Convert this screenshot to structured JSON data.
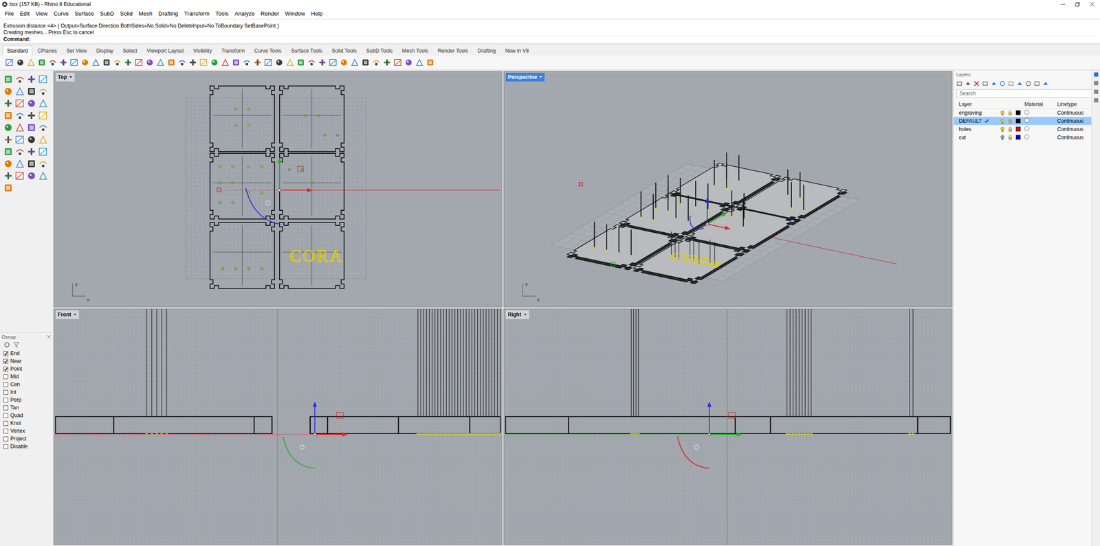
{
  "window": {
    "title": "box (157 KB) - Rhino 8 Educational"
  },
  "menu": [
    "File",
    "Edit",
    "View",
    "Curve",
    "Surface",
    "SubD",
    "Solid",
    "Mesh",
    "Drafting",
    "Transform",
    "Tools",
    "Analyze",
    "Render",
    "Window",
    "Help"
  ],
  "command": {
    "history": [
      "Extrusion distance <4> ( Output=Surface Direction BothSides=No Solid=No DeleteInput=No ToBoundary SetBasePoint )",
      "Creating meshes... Press Esc to cancel"
    ],
    "prompt": "Command:"
  },
  "toolbar_tabs": [
    {
      "label": "Standard",
      "selected": true
    },
    {
      "label": "CPlanes",
      "selected": false
    },
    {
      "label": "Set View",
      "selected": false
    },
    {
      "label": "Display",
      "selected": false
    },
    {
      "label": "Select",
      "selected": false
    },
    {
      "label": "Viewport Layout",
      "selected": false
    },
    {
      "label": "Visibility",
      "selected": false
    },
    {
      "label": "Transform",
      "selected": false
    },
    {
      "label": "Curve Tools",
      "selected": false
    },
    {
      "label": "Surface Tools",
      "selected": false
    },
    {
      "label": "Solid Tools",
      "selected": false
    },
    {
      "label": "SubD Tools",
      "selected": false
    },
    {
      "label": "Mesh Tools",
      "selected": false
    },
    {
      "label": "Render Tools",
      "selected": false
    },
    {
      "label": "Drafting",
      "selected": false
    },
    {
      "label": "New in V8",
      "selected": false
    }
  ],
  "viewports": [
    {
      "label": "Top",
      "active": false,
      "kind": "top",
      "axes": [
        "y",
        "x"
      ]
    },
    {
      "label": "Perspective",
      "active": true,
      "kind": "perspective",
      "axes": [
        "y",
        "x"
      ]
    },
    {
      "label": "Front",
      "active": false,
      "kind": "front",
      "axes": []
    },
    {
      "label": "Right",
      "active": false,
      "kind": "right",
      "axes": []
    }
  ],
  "engraving_text": "CORA",
  "layers": {
    "title": "Layers",
    "search_placeholder": "Search",
    "columns": [
      "Layer",
      "Material",
      "Linetype"
    ],
    "rows": [
      {
        "name": "engraving",
        "current": false,
        "selected": false,
        "visible": true,
        "color": "#000000",
        "linetype": "Continuous"
      },
      {
        "name": "DEFAULT",
        "current": true,
        "selected": true,
        "visible": true,
        "color": "#000000",
        "linetype": "Continuous"
      },
      {
        "name": "holes",
        "current": false,
        "selected": false,
        "visible": true,
        "color": "#e00000",
        "linetype": "Continuous"
      },
      {
        "name": "cut",
        "current": false,
        "selected": false,
        "visible": false,
        "color": "#0000e0",
        "linetype": "Continuous"
      }
    ]
  },
  "osnap": {
    "title": "Osnap",
    "items": [
      {
        "label": "End",
        "checked": true
      },
      {
        "label": "Near",
        "checked": true
      },
      {
        "label": "Point",
        "checked": true
      },
      {
        "label": "Mid",
        "checked": false
      },
      {
        "label": "Cen",
        "checked": false
      },
      {
        "label": "Int",
        "checked": false
      },
      {
        "label": "Perp",
        "checked": false
      },
      {
        "label": "Tan",
        "checked": false
      },
      {
        "label": "Quad",
        "checked": false
      },
      {
        "label": "Knot",
        "checked": false
      },
      {
        "label": "Vertex",
        "checked": false
      },
      {
        "label": "Project",
        "checked": false
      },
      {
        "label": "Disable",
        "checked": false
      }
    ]
  }
}
